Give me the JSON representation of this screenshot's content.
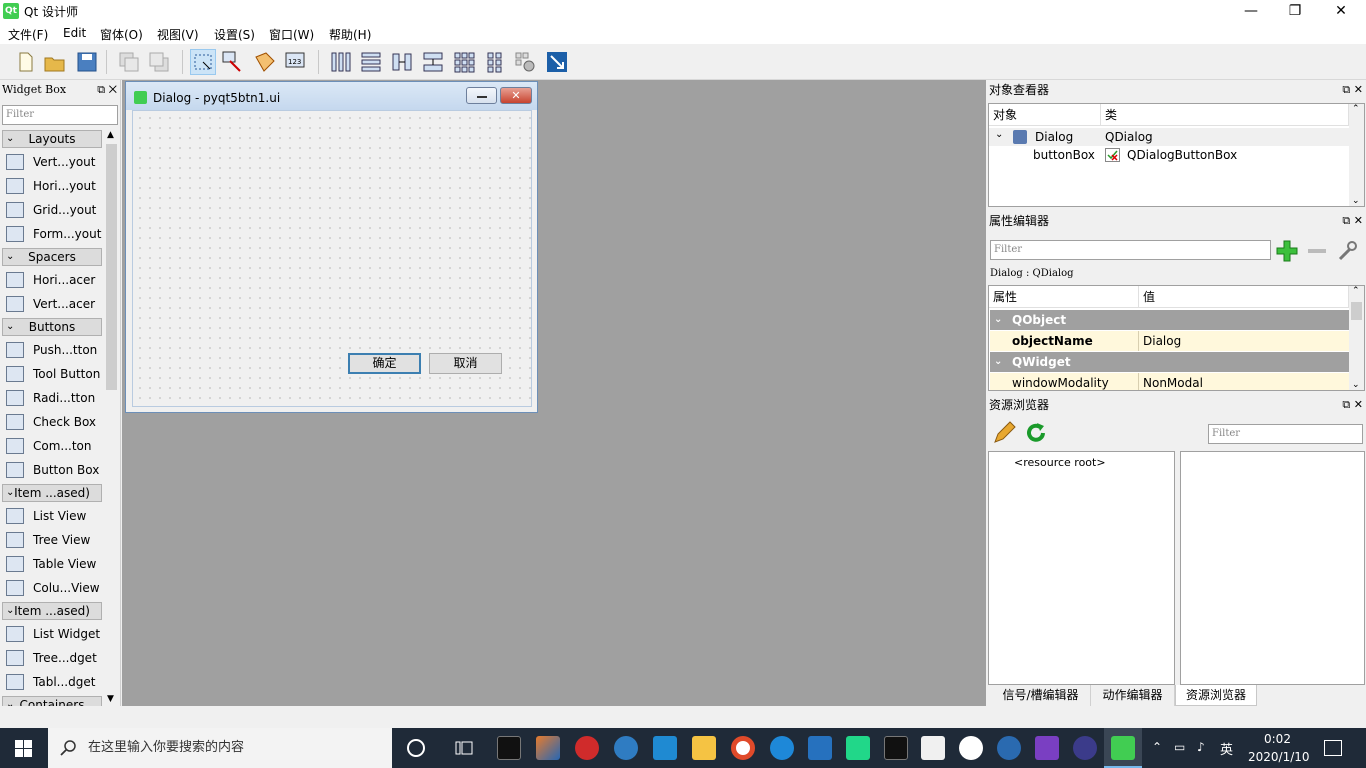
{
  "window": {
    "title": "Qt 设计师",
    "icon": "qt-designer-icon",
    "min": "—",
    "max": "❐",
    "close": "✕"
  },
  "menu": [
    "文件(F)",
    "Edit",
    "窗体(O)",
    "视图(V)",
    "设置(S)",
    "窗口(W)",
    "帮助(H)"
  ],
  "widget_box": {
    "title": "Widget Box",
    "filter_placeholder": "Filter",
    "sections": [
      {
        "label": "Layouts",
        "items": [
          "Vert...yout",
          "Hori...yout",
          "Grid...yout",
          "Form...yout"
        ]
      },
      {
        "label": "Spacers",
        "items": [
          "Hori...acer",
          "Vert...acer"
        ]
      },
      {
        "label": "Buttons",
        "items": [
          "Push...tton",
          "Tool Button",
          "Radi...tton",
          "Check Box",
          "Com...ton",
          "Button Box"
        ]
      },
      {
        "label": "Item ...ased)",
        "items": [
          "List View",
          "Tree View",
          "Table View",
          "Colu...View"
        ]
      },
      {
        "label": "Item ...ased)",
        "items": [
          "List Widget",
          "Tree...dget",
          "Tabl...dget"
        ]
      },
      {
        "label": "Containers",
        "items": []
      }
    ]
  },
  "dialog": {
    "title": "Dialog - pyqt5btn1.ui",
    "ok": "确定",
    "cancel": "取消"
  },
  "object_inspector": {
    "title": "对象查看器",
    "col_object": "对象",
    "col_class": "类",
    "rows": [
      {
        "object": "Dialog",
        "class": "QDialog"
      },
      {
        "object": "buttonBox",
        "class": "QDialogButtonBox"
      }
    ]
  },
  "property_editor": {
    "title": "属性编辑器",
    "filter_placeholder": "Filter",
    "context": "Dialog : QDialog",
    "col_prop": "属性",
    "col_value": "值",
    "groups": [
      {
        "name": "QObject",
        "props": [
          {
            "name": "objectName",
            "value": "Dialog"
          }
        ]
      },
      {
        "name": "QWidget",
        "props": [
          {
            "name": "windowModality",
            "value": "NonModal"
          }
        ]
      }
    ]
  },
  "resource_browser": {
    "title": "资源浏览器",
    "filter_placeholder": "Filter",
    "root": "<resource root>"
  },
  "bottom_tabs": [
    "信号/槽编辑器",
    "动作编辑器",
    "资源浏览器"
  ],
  "taskbar": {
    "search_placeholder": "在这里输入你要搜索的内容",
    "ime": "英",
    "time": "0:02",
    "date": "2020/1/10"
  },
  "colors": {
    "accent": "#3c7fb1",
    "qt_green": "#41cd52",
    "taskbar": "#1f2a38",
    "mdi_bg": "#a0a0a0"
  }
}
